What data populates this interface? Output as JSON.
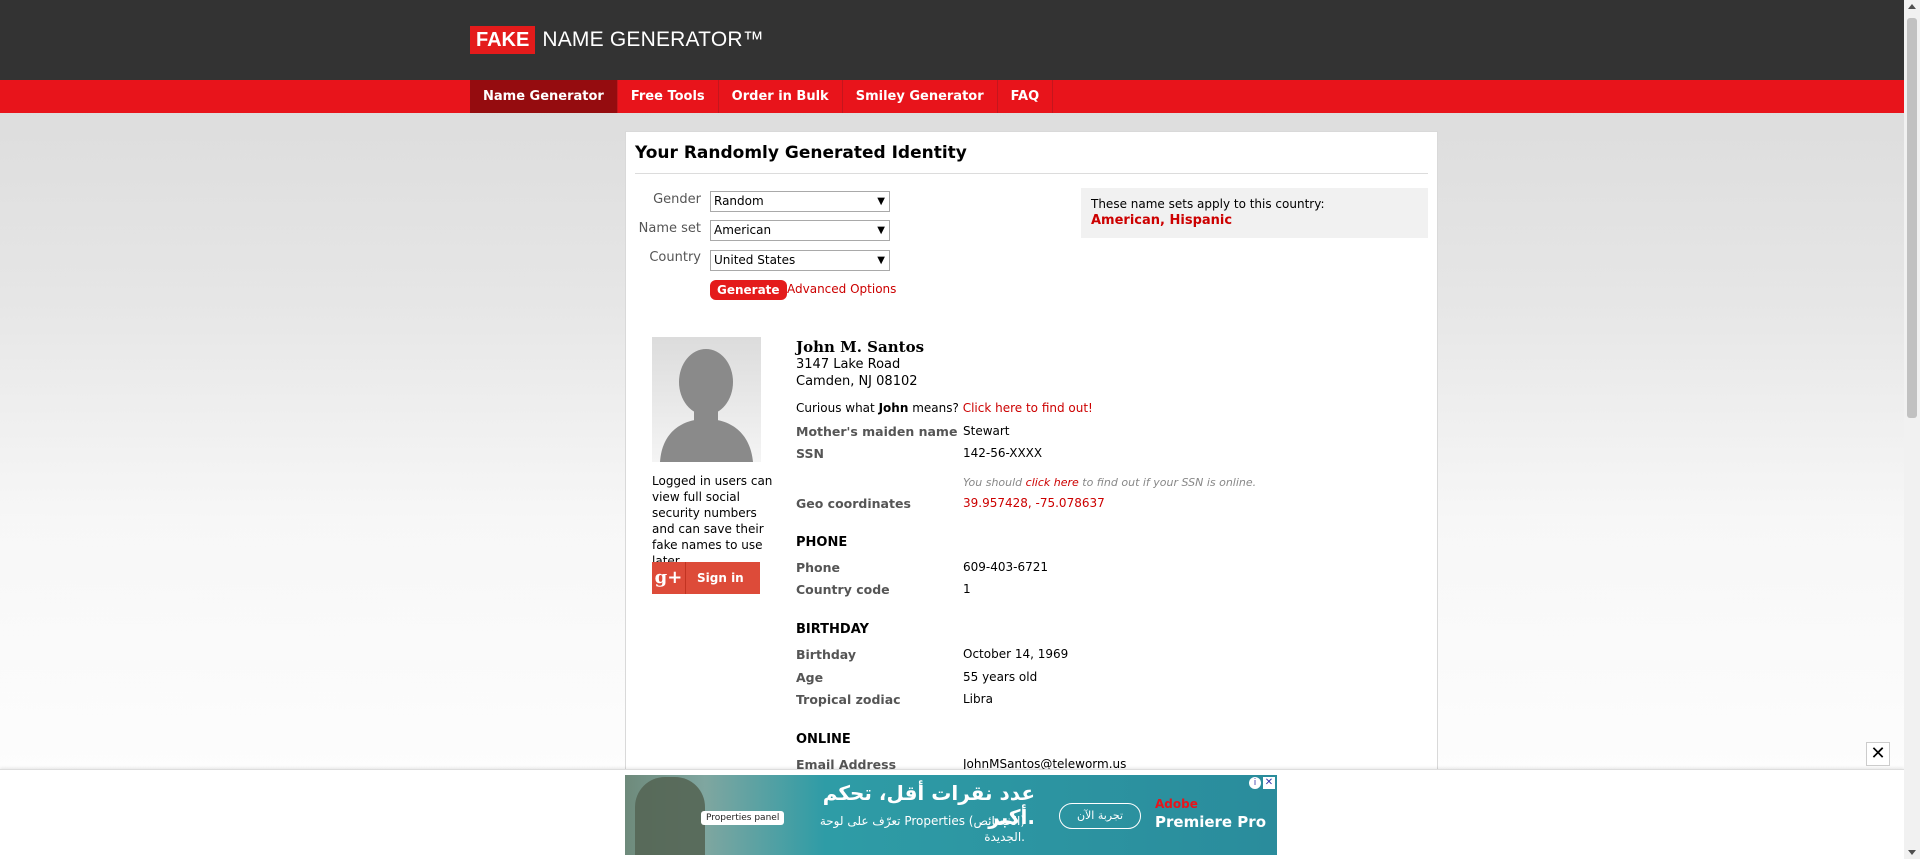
{
  "header": {
    "logo_fake": "FAKE",
    "logo_rest": "NAME GENERATOR™"
  },
  "nav": {
    "items": [
      {
        "label": "Name Generator",
        "active": true
      },
      {
        "label": "Free Tools"
      },
      {
        "label": "Order in Bulk"
      },
      {
        "label": "Smiley Generator"
      },
      {
        "label": "FAQ"
      }
    ]
  },
  "card": {
    "title": "Your Randomly Generated Identity"
  },
  "form": {
    "gender_label": "Gender",
    "gender_value": "Random",
    "nameset_label": "Name set",
    "nameset_value": "American",
    "country_label": "Country",
    "country_value": "United States",
    "generate_label": "Generate",
    "advanced_label": "Advanced Options"
  },
  "country_box": {
    "text": "These name sets apply to this country:",
    "sets": "American, Hispanic"
  },
  "sidebar": {
    "login_text": "Logged in users can view full social security numbers and can save their fake names to use later.",
    "signin_icon": "g+",
    "signin_label": "Sign in"
  },
  "identity": {
    "name": "John M. Santos",
    "street": "3147 Lake Road",
    "city": "Camden, NJ 08102",
    "curious_prefix": "Curious what",
    "curious_name": "John",
    "curious_mid": "means?",
    "curious_link": "Click here to find out!",
    "maiden_label": "Mother's maiden name",
    "maiden_value": "Stewart",
    "ssn_label": "SSN",
    "ssn_value": "142-56-XXXX",
    "ssn_note_prefix": "You should",
    "ssn_note_link": "click here",
    "ssn_note_suffix": "to find out if your SSN is online.",
    "geo_label": "Geo coordinates",
    "geo_value": "39.957428, -75.078637"
  },
  "phone": {
    "heading": "PHONE",
    "phone_label": "Phone",
    "phone_value": "609-403-6721",
    "code_label": "Country code",
    "code_value": "1"
  },
  "birthday": {
    "heading": "BIRTHDAY",
    "birthday_label": "Birthday",
    "birthday_value": "October 14, 1969",
    "age_label": "Age",
    "age_value": "55 years old",
    "zodiac_label": "Tropical zodiac",
    "zodiac_value": "Libra"
  },
  "online": {
    "heading": "ONLINE",
    "email_label": "Email Address",
    "email_value": "JohnMSantos@teleworm.us"
  },
  "ad": {
    "close_glyph": "✕",
    "props_label": "Properties panel",
    "headline": "عدد نقرات أقل، تحكم أكبر.",
    "subline": "تعرّف على لوحة Properties (الخصائص) الجديدة.",
    "button": "تجربة الآن",
    "brand": "Adobe",
    "product": "Premiere Pro"
  },
  "colors": {
    "brand_red": "#e8141b",
    "active_nav": "#950c0f",
    "header_dark": "#333333",
    "link_red": "#cc0000"
  }
}
